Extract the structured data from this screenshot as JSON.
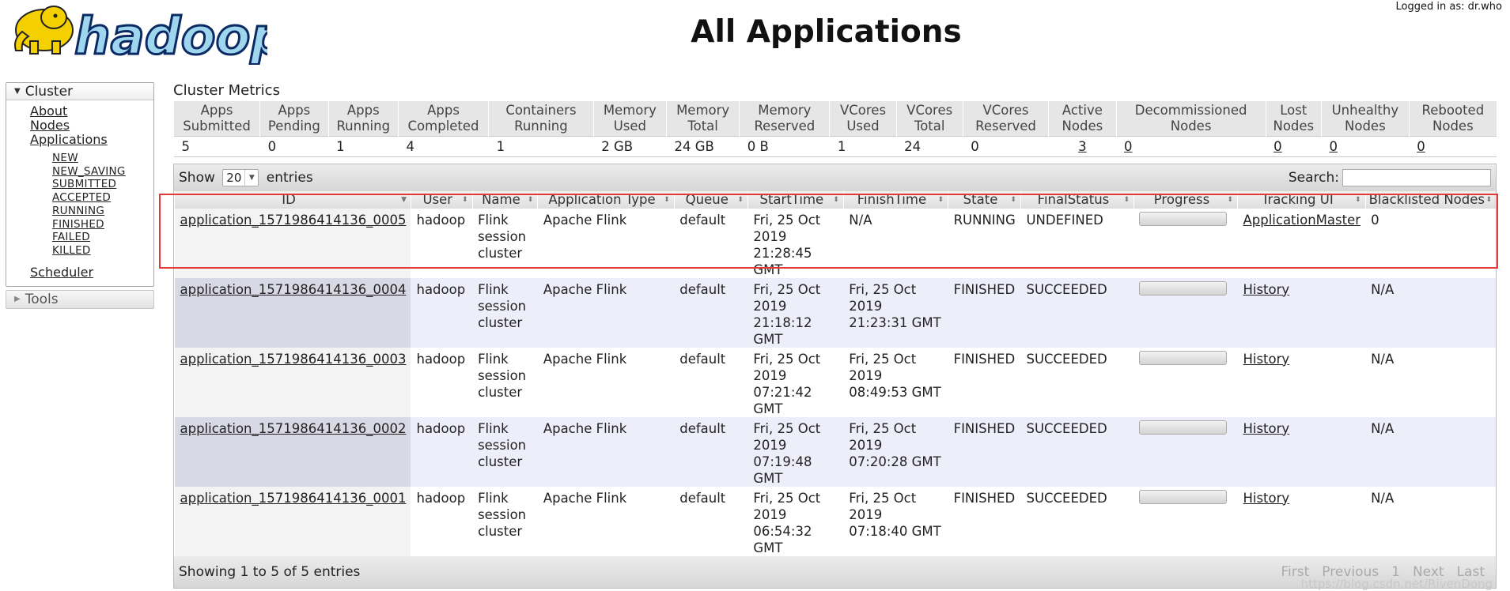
{
  "header": {
    "logo_text": "hadoop",
    "title": "All Applications",
    "user_info": "Logged in as: dr.who"
  },
  "nav": {
    "cluster_label": "Cluster",
    "items": [
      {
        "label": "About"
      },
      {
        "label": "Nodes"
      },
      {
        "label": "Applications"
      }
    ],
    "app_states": [
      "NEW",
      "NEW_SAVING",
      "SUBMITTED",
      "ACCEPTED",
      "RUNNING",
      "FINISHED",
      "FAILED",
      "KILLED"
    ],
    "scheduler_label": "Scheduler",
    "tools_label": "Tools"
  },
  "metrics": {
    "title": "Cluster Metrics",
    "headers": [
      [
        "Apps",
        "Submitted"
      ],
      [
        "Apps",
        "Pending"
      ],
      [
        "Apps",
        "Running"
      ],
      [
        "Apps",
        "Completed"
      ],
      [
        "Containers",
        "Running"
      ],
      [
        "Memory",
        "Used"
      ],
      [
        "Memory",
        "Total"
      ],
      [
        "Memory",
        "Reserved"
      ],
      [
        "VCores",
        "Used"
      ],
      [
        "VCores",
        "Total"
      ],
      [
        "VCores",
        "Reserved"
      ],
      [
        "Active",
        "Nodes"
      ],
      [
        "Decommissioned",
        "Nodes"
      ],
      [
        "Lost",
        "Nodes"
      ],
      [
        "Unhealthy",
        "Nodes"
      ],
      [
        "Rebooted",
        "Nodes"
      ]
    ],
    "values": [
      "5",
      "0",
      "1",
      "4",
      "1",
      "2 GB",
      "24 GB",
      "0 B",
      "1",
      "24",
      "0",
      "3",
      "0",
      "0",
      "0",
      "0"
    ]
  },
  "apps": {
    "show_label": "Show",
    "page_length": "20",
    "entries_label": "entries",
    "search_label": "Search:",
    "search_value": "",
    "columns": [
      "ID",
      "User",
      "Name",
      "Application Type",
      "Queue",
      "StartTime",
      "FinishTime",
      "State",
      "FinalStatus",
      "Progress",
      "Tracking UI",
      "Blacklisted Nodes"
    ],
    "rows": [
      {
        "id": "application_1571986414136_0005",
        "user": "hadoop",
        "name": "Flink session cluster",
        "type": "Apache Flink",
        "queue": "default",
        "start": "Fri, 25 Oct 2019 21:28:45 GMT",
        "finish": "N/A",
        "state": "RUNNING",
        "final_status": "UNDEFINED",
        "progress": 0,
        "tracking": "ApplicationMaster",
        "blacklisted": "0"
      },
      {
        "id": "application_1571986414136_0004",
        "user": "hadoop",
        "name": "Flink session cluster",
        "type": "Apache Flink",
        "queue": "default",
        "start": "Fri, 25 Oct 2019 21:18:12 GMT",
        "finish": "Fri, 25 Oct 2019 21:23:31 GMT",
        "state": "FINISHED",
        "final_status": "SUCCEEDED",
        "progress": 0,
        "tracking": "History",
        "blacklisted": "N/A"
      },
      {
        "id": "application_1571986414136_0003",
        "user": "hadoop",
        "name": "Flink session cluster",
        "type": "Apache Flink",
        "queue": "default",
        "start": "Fri, 25 Oct 2019 07:21:42 GMT",
        "finish": "Fri, 25 Oct 2019 08:49:53 GMT",
        "state": "FINISHED",
        "final_status": "SUCCEEDED",
        "progress": 0,
        "tracking": "History",
        "blacklisted": "N/A"
      },
      {
        "id": "application_1571986414136_0002",
        "user": "hadoop",
        "name": "Flink session cluster",
        "type": "Apache Flink",
        "queue": "default",
        "start": "Fri, 25 Oct 2019 07:19:48 GMT",
        "finish": "Fri, 25 Oct 2019 07:20:28 GMT",
        "state": "FINISHED",
        "final_status": "SUCCEEDED",
        "progress": 0,
        "tracking": "History",
        "blacklisted": "N/A"
      },
      {
        "id": "application_1571986414136_0001",
        "user": "hadoop",
        "name": "Flink session cluster",
        "type": "Apache Flink",
        "queue": "default",
        "start": "Fri, 25 Oct 2019 06:54:32 GMT",
        "finish": "Fri, 25 Oct 2019 07:18:40 GMT",
        "state": "FINISHED",
        "final_status": "SUCCEEDED",
        "progress": 0,
        "tracking": "History",
        "blacklisted": "N/A"
      }
    ],
    "info": "Showing 1 to 5 of 5 entries",
    "pagination": [
      "First",
      "Previous",
      "1",
      "Next",
      "Last"
    ],
    "watermark": "https://blog.csdn.net/RivenDong"
  },
  "colors": {
    "highlight": "#e53935",
    "logo_fill": "#9fd6ee",
    "logo_outline": "#0b2a63",
    "elephant": "#f5d000"
  }
}
